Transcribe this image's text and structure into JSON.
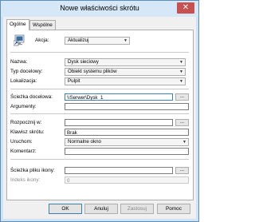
{
  "window": {
    "title": "Nowe właściwości skrótu",
    "close_glyph": "✕"
  },
  "tabs": [
    {
      "label": "Ogólne",
      "active": true
    },
    {
      "label": "Wspólne",
      "active": false
    }
  ],
  "general": {
    "action": {
      "label": "Akcja:",
      "value": "Aktualizuj"
    },
    "name": {
      "label": "Nazwa:",
      "value": "Dysk sieciowy"
    },
    "target_type": {
      "label": "Typ docelowy:",
      "value": "Obiekt systemu plików"
    },
    "location": {
      "label": "Lokalizacja:",
      "value": "Pulpit"
    },
    "target_path": {
      "label": "Ścieżka docelowa:",
      "value": "\\\\Serwer\\Dysk_1",
      "browse": "..."
    },
    "arguments": {
      "label": "Argumenty:",
      "value": ""
    },
    "start_in": {
      "label": "Rozpocznij w:",
      "value": "",
      "browse": "..."
    },
    "shortcut_key": {
      "label": "Klawisz skrótu:",
      "value": "Brak"
    },
    "run": {
      "label": "Uruchom:",
      "value": "Normalne okno"
    },
    "comment": {
      "label": "Komentarz:",
      "value": ""
    },
    "icon_path": {
      "label": "Ścieżka pliku ikony:",
      "value": "",
      "browse": "..."
    },
    "icon_index": {
      "label": "Indeks ikony:",
      "value": "0"
    }
  },
  "buttons": {
    "ok": "OK",
    "cancel": "Anuluj",
    "apply": "Zastosuj",
    "help": "Pomoc"
  }
}
